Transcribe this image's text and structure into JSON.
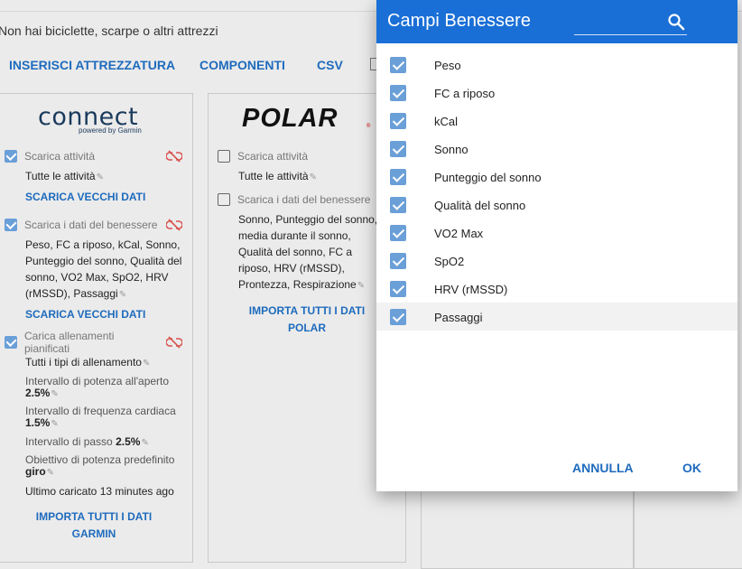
{
  "page": {
    "notice": "Non hai biciclette, scarpe o altri attrezzi",
    "tabs": [
      "INSERISCI ATTREZZATURA",
      "COMPONENTI",
      "CSV"
    ]
  },
  "garmin": {
    "logo": "connect",
    "logo_sub": "powered by Garmin",
    "download_activities_label": "Scarica attività",
    "download_activities_checked": true,
    "all_activities": "Tutte le attività",
    "download_old_data_1": "SCARICA VECCHI DATI",
    "wellness_label": "Scarica i dati del benessere",
    "wellness_checked": true,
    "wellness_fields": "Peso, FC a riposo, kCal, Sonno, Punteggio del sonno, Qualità del sonno, VO2 Max, SpO2, HRV (rMSSD), Passaggi",
    "download_old_data_2": "SCARICA VECCHI DATI",
    "upload_workouts_label": "Carica allenamenti pianificati",
    "upload_workouts_checked": true,
    "all_workout_types": "Tutti i tipi di allenamento",
    "outdoor_power_label": "Intervallo di potenza all'aperto",
    "outdoor_power_value": "2.5%",
    "hr_range_label": "Intervallo di frequenza cardiaca",
    "hr_range_value": "1.5%",
    "pace_range_label": "Intervallo di passo",
    "pace_range_value": "2.5%",
    "default_power_target_label": "Obiettivo di potenza predefinito",
    "default_power_target_value": "giro",
    "last_uploaded": "Ultimo caricato 13 minutes ago",
    "import_all": "IMPORTA TUTTI I DATI GARMIN",
    "unlink_color": "#d9534f"
  },
  "polar": {
    "logo": "POLAR",
    "logo_r": "®",
    "download_activities_label": "Scarica attività",
    "download_activities_checked": false,
    "all_activities": "Tutte le attività",
    "wellness_label": "Scarica i dati del benessere",
    "wellness_checked": false,
    "wellness_fields": "Sonno, Punteggio del sonno, media durante il sonno, Qualità del sonno, FC a riposo, HRV (rMSSD), Prontezza, Respirazione",
    "import_all": "IMPORTA TUTTI I DATI POLAR"
  },
  "dialog": {
    "title": "Campi Benessere",
    "search_icon": "search-icon",
    "header_color": "#1a6fd6",
    "items": [
      {
        "label": "Peso",
        "checked": true
      },
      {
        "label": "FC a riposo",
        "checked": true
      },
      {
        "label": "kCal",
        "checked": true
      },
      {
        "label": "Sonno",
        "checked": true
      },
      {
        "label": "Punteggio del sonno",
        "checked": true
      },
      {
        "label": "Qualità del sonno",
        "checked": true
      },
      {
        "label": "VO2 Max",
        "checked": true
      },
      {
        "label": "SpO2",
        "checked": true
      },
      {
        "label": "HRV (rMSSD)",
        "checked": true
      },
      {
        "label": "Passaggi",
        "checked": true
      }
    ],
    "cancel_label": "ANNULLA",
    "ok_label": "OK"
  }
}
